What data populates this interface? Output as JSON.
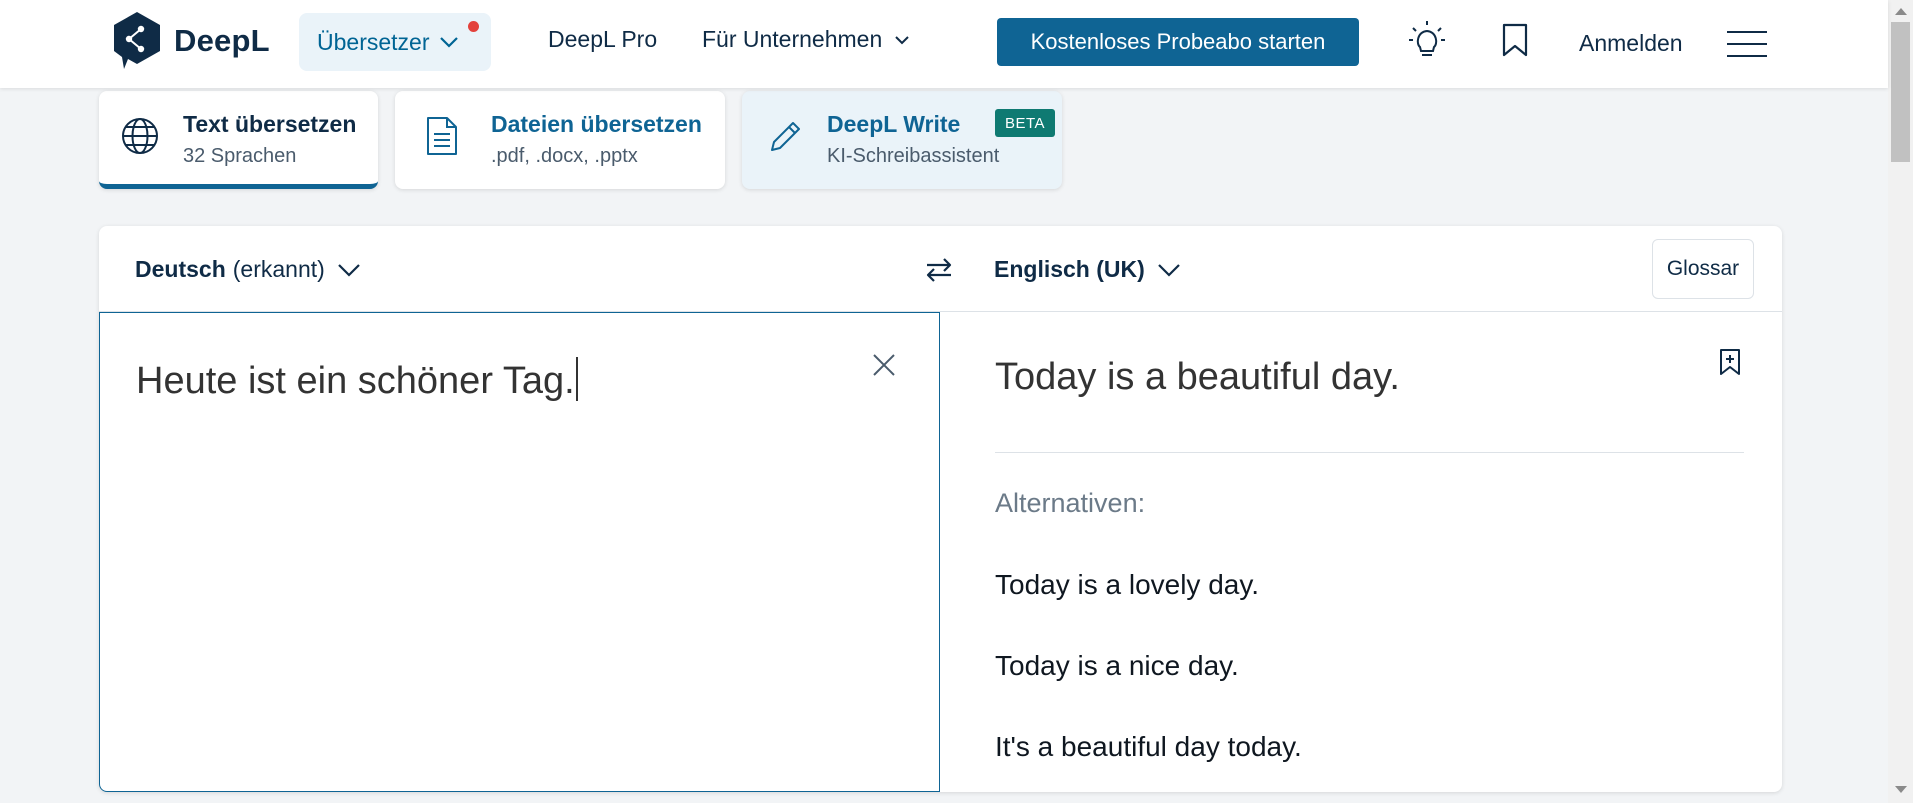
{
  "header": {
    "logo_text": "DeepL",
    "nav_translator": "Übersetzer",
    "nav_pro": "DeepL Pro",
    "nav_business": "Für Unternehmen",
    "cta": "Kostenloses Probeabo starten",
    "login": "Anmelden",
    "colors": {
      "accent": "#0f6494",
      "notification_dot": "#e3413c",
      "text": "#0f2b46"
    }
  },
  "modes": [
    {
      "title": "Text übersetzen",
      "subtitle": "32 Sprachen"
    },
    {
      "title": "Dateien übersetzen",
      "subtitle": ".pdf, .docx, .pptx"
    },
    {
      "title": "DeepL Write",
      "subtitle": "KI-Schreibassistent",
      "badge": "BETA"
    }
  ],
  "translator": {
    "source_lang": "Deutsch",
    "source_detected": "(erkannt)",
    "target_lang": "Englisch (UK)",
    "glossary": "Glossar",
    "source_text": "Heute ist ein schöner Tag.",
    "target_text": "Today is a beautiful day.",
    "alternatives_label": "Alternativen:",
    "alternatives": [
      "Today is a lovely day.",
      "Today is a nice day.",
      "It's a beautiful day today."
    ]
  },
  "icons": {
    "logo": "deepl-logo-icon",
    "chevron": "chevron-down-icon",
    "lightbulb": "lightbulb-icon",
    "bookmark": "bookmark-icon",
    "menu": "hamburger-menu-icon",
    "globe": "globe-icon",
    "document": "document-icon",
    "pencil": "pencil-icon",
    "swap": "swap-arrows-icon",
    "close": "close-icon",
    "bookmark_add": "bookmark-add-icon"
  }
}
